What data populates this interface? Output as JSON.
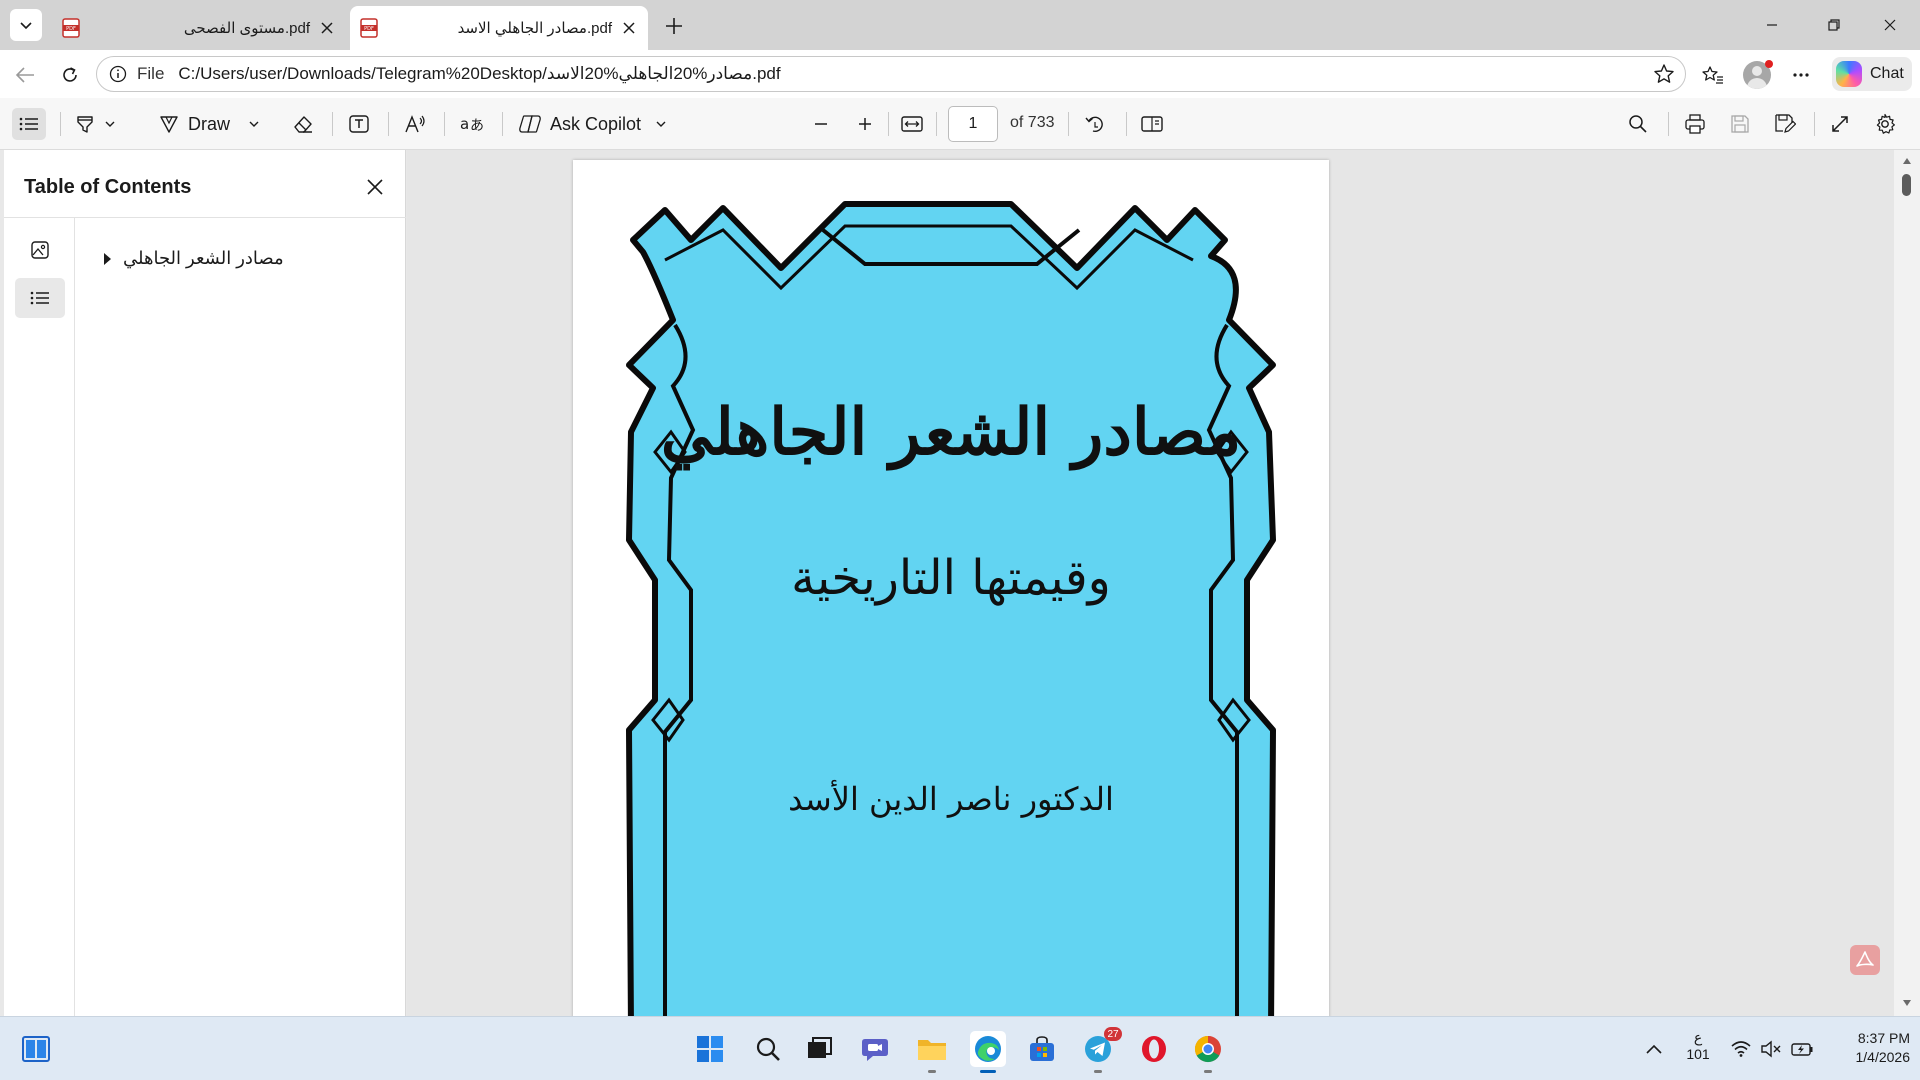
{
  "browser": {
    "tabs": [
      {
        "title": "مستوى الفصحى.pdf",
        "active": false
      },
      {
        "title": "مصادر الجاهلي الاسد.pdf",
        "active": true
      }
    ],
    "address": {
      "scheme_label": "File",
      "url": "C:/Users/user/Downloads/Telegram%20Desktop/مصادر%20الجاهلي%20الاسد.pdf"
    },
    "chat_label": "Chat"
  },
  "pdf_toolbar": {
    "draw_label": "Draw",
    "ask_copilot_label": "Ask Copilot",
    "page_number": "1",
    "page_count": "of 733"
  },
  "sidebar": {
    "title": "Table of Contents",
    "toc_items": [
      {
        "label": "مصادر الشعر الجاهلي"
      }
    ]
  },
  "document": {
    "cover": {
      "title": "مصادر الشعر الجاهلي",
      "subtitle": "وقيمتها التاريخية",
      "author": "الدكتور ناصر الدين الأسد",
      "background_color": "#62d4f2",
      "frame_color": "#0a0a0a"
    }
  },
  "taskbar": {
    "telegram_badge": "27",
    "lang_line1": "ع",
    "lang_line2": "101",
    "time": "8:37 PM",
    "date": "1/4/2026"
  },
  "colors": {
    "accent": "#005fb8",
    "tab_strip": "#d3d3d3",
    "toolbar": "#f7f7f7",
    "doc_background": "#e6e6e6"
  }
}
